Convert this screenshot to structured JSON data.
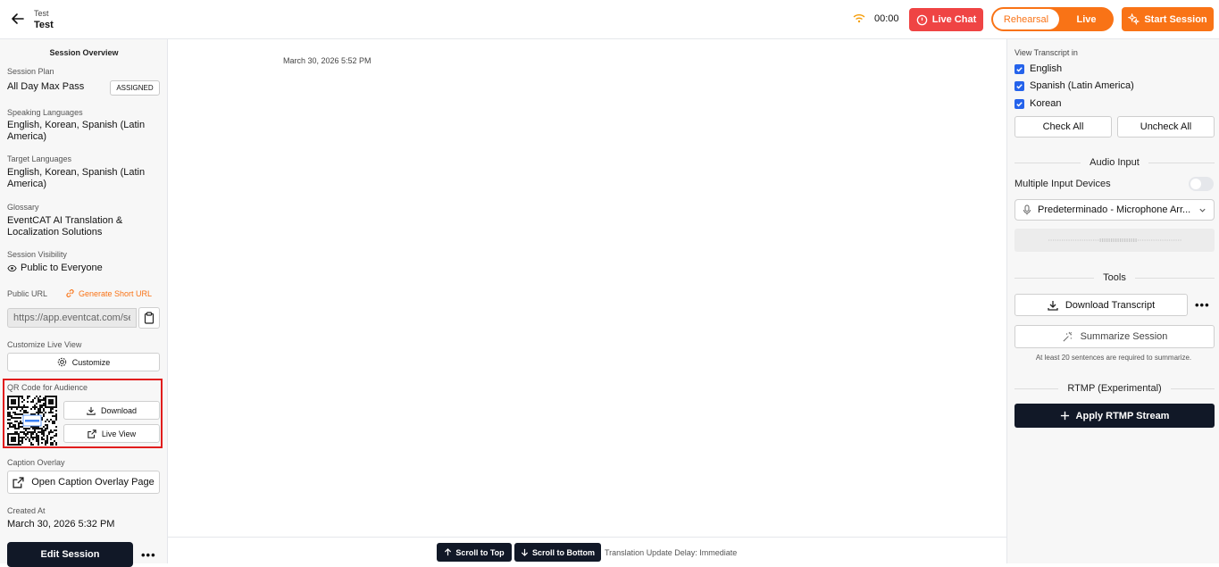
{
  "header": {
    "breadcrumb": "Test",
    "title": "Test",
    "timer": "00:00",
    "live_chat_label": "Live Chat",
    "mode_rehearsal": "Rehearsal",
    "mode_live": "Live",
    "start_session_label": "Start Session"
  },
  "left": {
    "section_title": "Session Overview",
    "session_plan_label": "Session Plan",
    "session_plan_value": "All Day Max Pass",
    "assigned_badge": "ASSIGNED",
    "speaking_languages_label": "Speaking Languages",
    "speaking_languages_value": "English, Korean, Spanish (Latin America)",
    "target_languages_label": "Target Languages",
    "target_languages_value": "English, Korean, Spanish (Latin America)",
    "glossary_label": "Glossary",
    "glossary_value": "EventCAT AI Translation & Localization Solutions",
    "visibility_label": "Session Visibility",
    "visibility_value": "Public to Everyone",
    "public_url_label": "Public URL",
    "generate_short_url": "Generate Short URL",
    "public_url_value": "https://app.eventcat.com/se",
    "customize_label": "Customize Live View",
    "customize_button": "Customize",
    "qr_label": "QR Code for Audience",
    "qr_download": "Download",
    "qr_live_view": "Live View",
    "caption_label": "Caption Overlay",
    "caption_button": "Open Caption Overlay Page",
    "created_label": "Created At",
    "created_value": "March 30, 2026 5:32 PM",
    "edit_session": "Edit Session",
    "more": "•••"
  },
  "center": {
    "transcript_timestamp": "March 30, 2026 5:52 PM",
    "scroll_top": "Scroll to Top",
    "scroll_bottom": "Scroll to Bottom",
    "translation_delay": "Translation Update Delay: Immediate"
  },
  "right": {
    "view_transcript_label": "View Transcript in",
    "languages": [
      {
        "label": "English",
        "checked": true
      },
      {
        "label": "Spanish (Latin America)",
        "checked": true
      },
      {
        "label": "Korean",
        "checked": true
      }
    ],
    "check_all": "Check All",
    "uncheck_all": "Uncheck All",
    "audio_input_title": "Audio Input",
    "multiple_devices_label": "Multiple Input Devices",
    "multiple_devices_on": false,
    "device_value": "Predeterminado - Microphone Arr...",
    "tools_title": "Tools",
    "download_transcript": "Download Transcript",
    "more": "•••",
    "summarize": "Summarize Session",
    "summarize_note": "At least 20 sentences are required to summarize.",
    "rtmp_title": "RTMP (Experimental)",
    "apply_rtmp": "Apply RTMP Stream"
  },
  "colors": {
    "accent_orange": "#f97316",
    "live_chat_red": "#ef4444",
    "dark": "#111827",
    "checkbox_blue": "#2563eb",
    "highlight_red": "#e11d1d"
  }
}
